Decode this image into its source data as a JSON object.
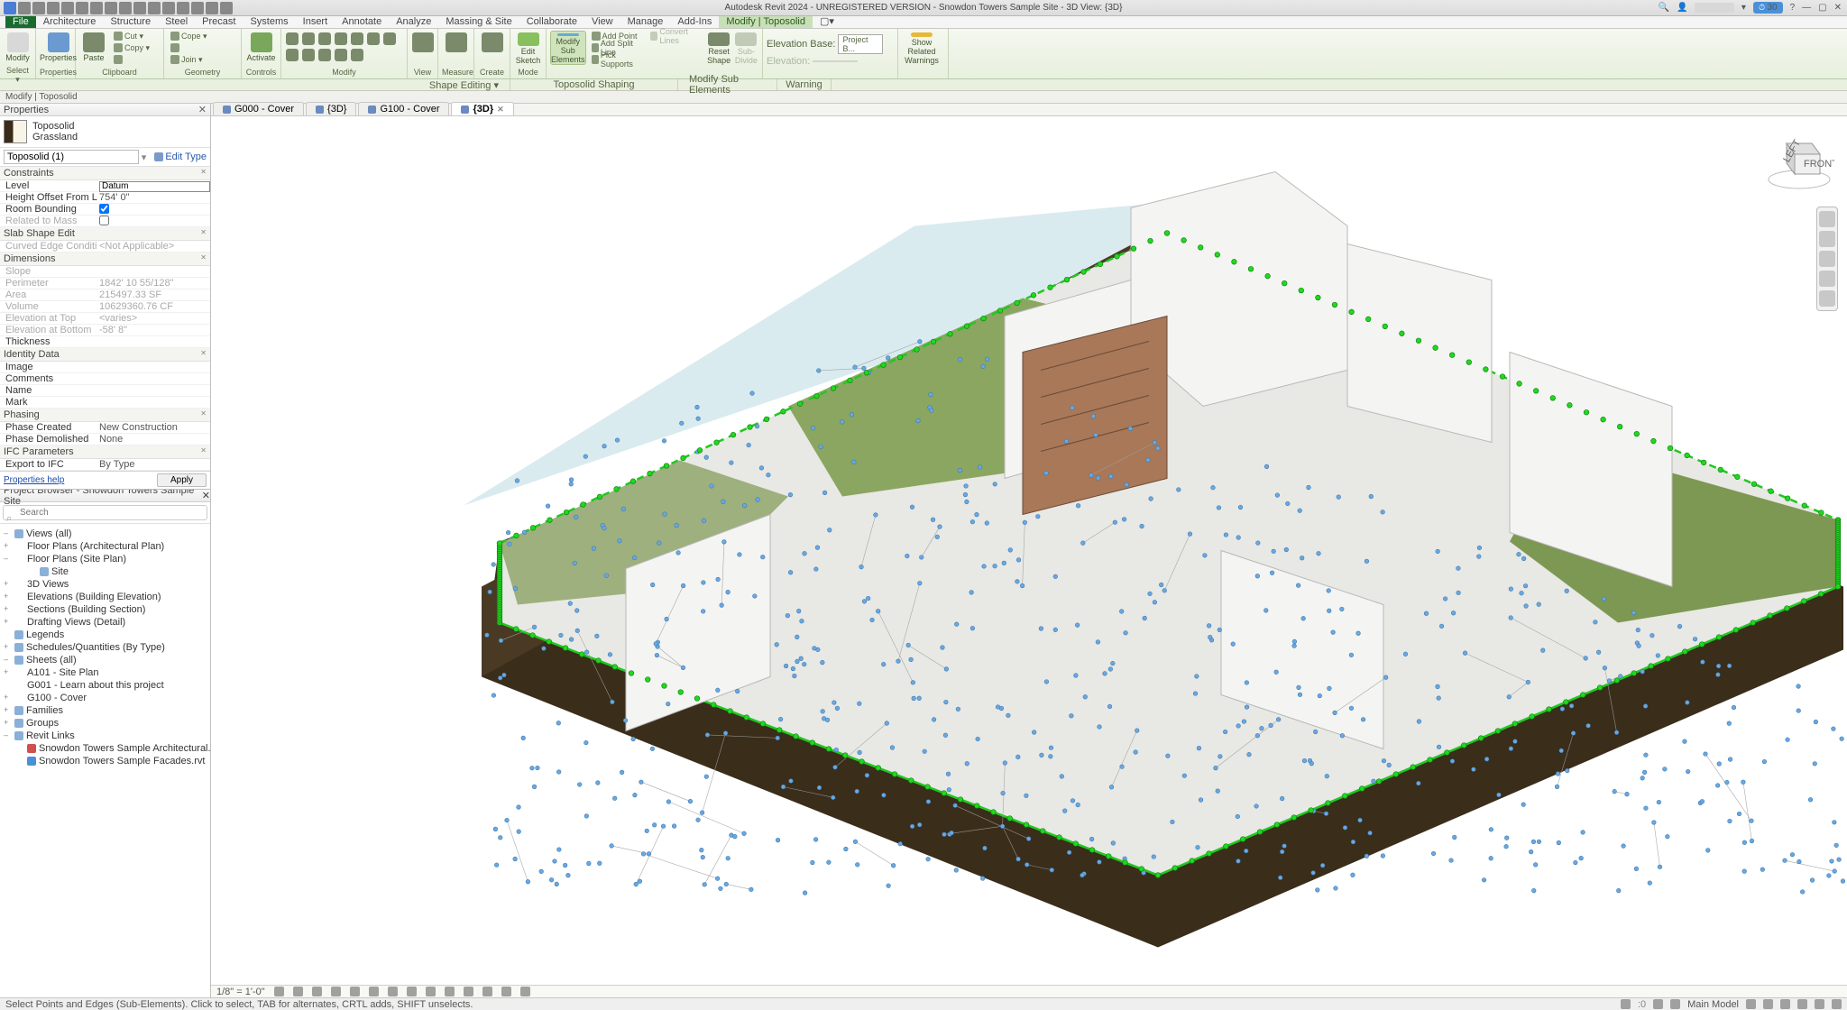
{
  "app": {
    "title": "Autodesk Revit 2024 - UNREGISTERED VERSION - Snowdon Towers Sample Site - 3D View: {3D}",
    "badge30": "30"
  },
  "menu_tabs": [
    "File",
    "Architecture",
    "Structure",
    "Steel",
    "Precast",
    "Systems",
    "Insert",
    "Annotate",
    "Analyze",
    "Massing & Site",
    "Collaborate",
    "View",
    "Manage",
    "Add-Ins",
    "Modify | Toposolid"
  ],
  "ribbon": {
    "select": {
      "modify": "Modify",
      "select": "Select ▾",
      "label": "Select ▾"
    },
    "properties": {
      "btn": "Properties",
      "label": "Properties"
    },
    "clipboard": {
      "paste": "Paste",
      "cut": "Cut ▾",
      "copy": "Copy ▾",
      "match": "",
      "label": "Clipboard"
    },
    "geometry": {
      "cope": "Cope ▾",
      "join": "Join ▾",
      "label": "Geometry"
    },
    "controls": {
      "activate": "Activate",
      "label": "Controls"
    },
    "modify": {
      "label": "Modify"
    },
    "view": {
      "label": "View"
    },
    "measure": {
      "label": "Measure"
    },
    "create": {
      "label": "Create"
    },
    "mode": {
      "edit_sketch": "Edit Sketch",
      "label": "Mode"
    },
    "shape_editing": {
      "modify_sub": "Modify Sub Elements",
      "add_point": "Add Point",
      "add_split": "Add Split Line",
      "pick_supports": "Pick Supports",
      "convert": "Convert Lines",
      "reset": "Reset Shape",
      "subdivide": "Sub-Divide",
      "label": "Shape Editing ▾"
    },
    "toposolid_shaping": {
      "elev_base": "Elevation Base:",
      "elev_base_val": "Project B...",
      "elevation": "Elevation:",
      "label": "Toposolid Shaping"
    },
    "modify_sub": {
      "label": "Modify Sub Elements"
    },
    "warning": {
      "show": "Show Related Warnings",
      "label": "Warning"
    }
  },
  "context_bar": "Modify | Toposolid",
  "properties": {
    "header": "Properties",
    "type_name": "Toposolid",
    "type_sub": "Grassland",
    "filter": "Toposolid (1)",
    "edit_type": "Edit Type",
    "groups": [
      {
        "name": "Constraints",
        "rows": [
          {
            "k": "Level",
            "v": "Datum",
            "input": true
          },
          {
            "k": "Height Offset From Level",
            "v": "754'  0\""
          },
          {
            "k": "Room Bounding",
            "v": "",
            "check": true,
            "checked": true
          },
          {
            "k": "Related to Mass",
            "v": "",
            "check": true,
            "checked": false,
            "dim": true
          }
        ]
      },
      {
        "name": "Slab Shape Edit",
        "rows": [
          {
            "k": "Curved Edge Condition",
            "v": "<Not Applicable>",
            "dim": true
          }
        ]
      },
      {
        "name": "Dimensions",
        "rows": [
          {
            "k": "Slope",
            "v": "",
            "dim": true
          },
          {
            "k": "Perimeter",
            "v": "1842'  10 55/128\"",
            "dim": true
          },
          {
            "k": "Area",
            "v": "215497.33 SF",
            "dim": true
          },
          {
            "k": "Volume",
            "v": "10629360.76 CF",
            "dim": true
          },
          {
            "k": "Elevation at Top",
            "v": "<varies>",
            "dim": true
          },
          {
            "k": "Elevation at Bottom",
            "v": "-58'  8\"",
            "dim": true
          },
          {
            "k": "Thickness",
            "v": ""
          }
        ]
      },
      {
        "name": "Identity Data",
        "rows": [
          {
            "k": "Image",
            "v": ""
          },
          {
            "k": "Comments",
            "v": ""
          },
          {
            "k": "Name",
            "v": ""
          },
          {
            "k": "Mark",
            "v": ""
          }
        ]
      },
      {
        "name": "Phasing",
        "rows": [
          {
            "k": "Phase Created",
            "v": "New Construction"
          },
          {
            "k": "Phase Demolished",
            "v": "None"
          }
        ]
      },
      {
        "name": "IFC Parameters",
        "rows": [
          {
            "k": "Export to IFC",
            "v": "By Type"
          }
        ]
      }
    ],
    "help": "Properties help",
    "apply": "Apply"
  },
  "project_browser": {
    "header": "Project Browser - Snowdon Towers Sample Site",
    "search_ph": "Search",
    "tree": [
      {
        "t": "Views (all)",
        "lvl": 0,
        "exp": "-",
        "icon": "v"
      },
      {
        "t": "Floor Plans (Architectural Plan)",
        "lvl": 1,
        "exp": "+"
      },
      {
        "t": "Floor Plans (Site Plan)",
        "lvl": 1,
        "exp": "-"
      },
      {
        "t": "Site",
        "lvl": 2,
        "exp": "",
        "icon": "s",
        "sel": false
      },
      {
        "t": "3D Views",
        "lvl": 1,
        "exp": "+"
      },
      {
        "t": "Elevations (Building Elevation)",
        "lvl": 1,
        "exp": "+"
      },
      {
        "t": "Sections (Building Section)",
        "lvl": 1,
        "exp": "+"
      },
      {
        "t": "Drafting Views (Detail)",
        "lvl": 1,
        "exp": "+"
      },
      {
        "t": "Legends",
        "lvl": 0,
        "exp": "",
        "icon": "l"
      },
      {
        "t": "Schedules/Quantities (By Type)",
        "lvl": 0,
        "exp": "+",
        "icon": "q"
      },
      {
        "t": "Sheets (all)",
        "lvl": 0,
        "exp": "-",
        "icon": "sh"
      },
      {
        "t": "A101 - Site Plan",
        "lvl": 1,
        "exp": "+"
      },
      {
        "t": "G001 - Learn about this project",
        "lvl": 1,
        "exp": ""
      },
      {
        "t": "G100 - Cover",
        "lvl": 1,
        "exp": "+"
      },
      {
        "t": "Families",
        "lvl": 0,
        "exp": "+",
        "icon": "f"
      },
      {
        "t": "Groups",
        "lvl": 0,
        "exp": "+",
        "icon": "g"
      },
      {
        "t": "Revit Links",
        "lvl": 0,
        "exp": "-",
        "icon": "rl"
      },
      {
        "t": "Snowdon Towers Sample Architectural.rvt",
        "lvl": 1,
        "exp": "",
        "icon": "red"
      },
      {
        "t": "Snowdon Towers Sample Facades.rvt",
        "lvl": 1,
        "exp": "",
        "icon": "blue"
      }
    ]
  },
  "doc_tabs": [
    {
      "label": "G000 - Cover",
      "active": false
    },
    {
      "label": "{3D}",
      "active": false
    },
    {
      "label": "G100 - Cover",
      "active": false
    },
    {
      "label": "{3D}",
      "active": true
    }
  ],
  "view_status": {
    "scale": "1/8\" = 1'-0\""
  },
  "app_status": {
    "left": "Select Points and Edges (Sub-Elements). Click to select, TAB for alternates, CRTL adds, SHIFT unselects.",
    "model": "Main Model"
  }
}
